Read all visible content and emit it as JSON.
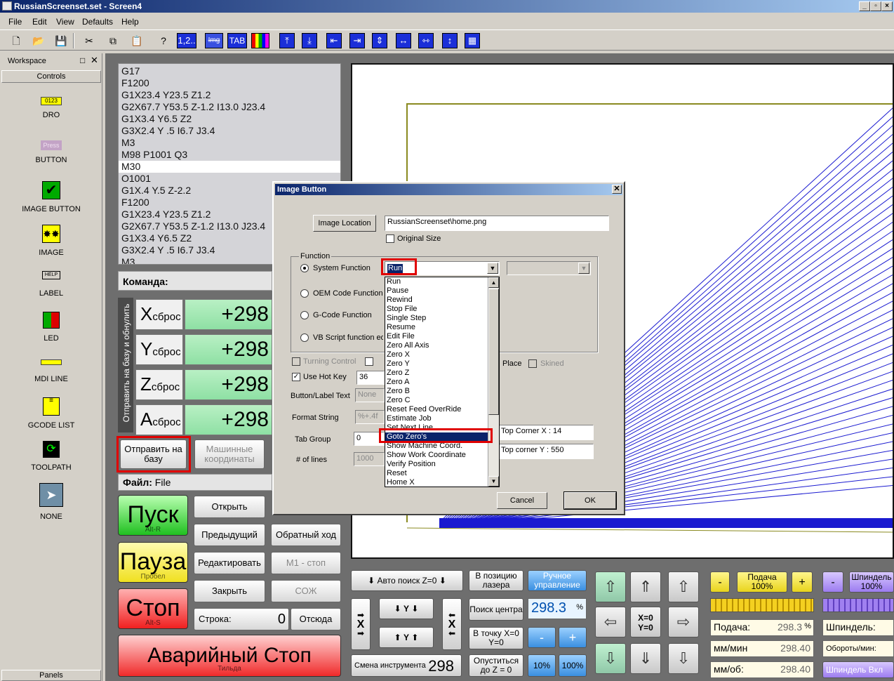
{
  "window": {
    "title": "RussianScreenset.set - Screen4"
  },
  "menu": [
    "File",
    "Edit",
    "View",
    "Defaults",
    "Help"
  ],
  "toolbar": {
    "numbering_label": "1,2..",
    "img_label": "Img",
    "tab_label": "TAB"
  },
  "workspace": {
    "title": "Workspace",
    "controls_tab": "Controls",
    "panels_tab": "Panels",
    "dro_sample": "0123",
    "button_sample": "Press",
    "label_sample": "HELP",
    "items": [
      "DRO",
      "BUTTON",
      "IMAGE BUTTON",
      "IMAGE",
      "LABEL",
      "LED",
      "MDI LINE",
      "GCODE LIST",
      "TOOLPATH",
      "NONE"
    ]
  },
  "gcode": [
    "G17",
    "F1200",
    "G1X23.4 Y23.5 Z1.2",
    "G2X67.7 Y53.5 Z-1.2 I13.0 J23.4",
    "G1X3.4 Y6.5 Z2",
    "G3X2.4 Y .5 I6.7 J3.4",
    "M3",
    "M98 P1001 Q3",
    "M30",
    "O1001",
    "G1X.4 Y.5 Z-2.2",
    "F1200",
    "G1X23.4 Y23.5 Z1.2",
    "G2X67.7 Y53.5 Z-1.2 I13.0 J23.4",
    "G1X3.4 Y6.5 Z2",
    "G3X2.4 Y .5 I6.7 J3.4",
    "M3"
  ],
  "command_label": "Команда:",
  "dro_side_label": "Отправить на базу и обнулить",
  "dro": [
    {
      "axis": "X",
      "reset": "сброс",
      "value": "+298"
    },
    {
      "axis": "Y",
      "reset": "сброс",
      "value": "+298"
    },
    {
      "axis": "Z",
      "reset": "сброс",
      "value": "+298"
    },
    {
      "axis": "A",
      "reset": "сброс",
      "value": "+298"
    }
  ],
  "home_button": "Отправить на базу",
  "machine_coords_button": "Машинные координаты",
  "file_label": "Файл:",
  "file_value": "File",
  "big": {
    "start": "Пуск",
    "start_hint": "Alt-R",
    "pause": "Пауза",
    "pause_hint": "Пробел",
    "stop": "Стоп",
    "stop_hint": "Alt-S",
    "estop": "Аварийный Стоп",
    "estop_hint": "Тильда"
  },
  "file_buttons": {
    "open": "Открыть",
    "prev": "Предыдущий",
    "rewind": "Обратный ход",
    "edit": "Редактировать",
    "m1": "M1 - стоп",
    "close": "Закрыть",
    "coolant": "СОЖ",
    "line_label": "Строка:",
    "line_value": "0",
    "from_here": "Отсюда"
  },
  "dialog": {
    "title": "Image Button",
    "image_location_btn": "Image Location",
    "image_path": "RussianScreenset\\home.png",
    "original_size": "Original Size",
    "function_group": "Function",
    "system_function": "System Function",
    "oem_function": "OEM Code Function",
    "gcode_function": "G-Code Function",
    "vb_function": "VB Script function edit",
    "selected": "Run",
    "turning_control": "Turning Control",
    "use_hotkey": "Use Hot Key",
    "hotkey_value": "36",
    "button_text_label": "Button/Label Text",
    "button_text_value": "None",
    "format_label": "Format String",
    "format_value": "%+.4f",
    "tab_group_label": "Tab Group",
    "tab_group_value": "0",
    "lines_label": "# of lines",
    "lines_value": "1000",
    "place": "Place",
    "skined": "Skined",
    "top_x": "Top Corner X : 14",
    "top_y": "Top corner Y : 550",
    "cancel": "Cancel",
    "ok": "OK",
    "options": [
      "Run",
      "Pause",
      "Rewind",
      "Stop File",
      "Single Step",
      "Resume",
      "Edit File",
      "Zero All Axis",
      "Zero X",
      "Zero Y",
      "Zero Z",
      "Zero A",
      "Zero B",
      "Zero C",
      "Reset Feed OverRide",
      "Estimate Job",
      "Set Next Line",
      "Goto Zero's",
      "Show Machine Coord.",
      "Show Work Coordinate",
      "Verify Position",
      "Reset",
      "Home X"
    ],
    "highlighted_index": 17
  },
  "bottom": {
    "auto_z": "Авто поиск Z=0",
    "laser_pos": "В позицию лазера",
    "manual": "Ручное управление",
    "find_center": "Поиск центра",
    "feed_value": "298.3",
    "percent": "%",
    "to_point": "В точку X=0 Y=0",
    "tool_change": "Смена инструмента",
    "tool_value": "298",
    "lower_z": "Опуститься до Z = 0",
    "pct10": "10%",
    "pct100": "100%",
    "minus": "-",
    "plus": "+",
    "y": "Y",
    "x": "X",
    "xy_zero": "X=0 Y=0",
    "feed_btn": "Подача 100%",
    "feed_label": "Подача:",
    "feed_readout": "298.3",
    "mm_min": "мм/мин",
    "mm_min_val": "298.40",
    "mm_rev": "мм/об:",
    "mm_rev_val": "298.40",
    "spindle_btn": "Шпиндель 100%",
    "spindle_label": "Шпиндель:",
    "rpm_label": "Обороты/мин:",
    "spindle_on": "Шпиндель Вкл"
  }
}
